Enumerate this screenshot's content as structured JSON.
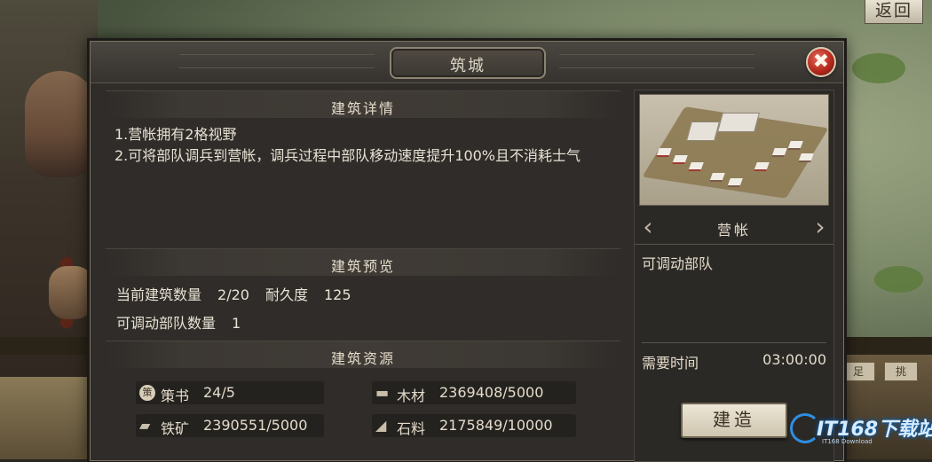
{
  "background": {
    "back_button": "返回",
    "right_tabs": [
      "足",
      "挑"
    ]
  },
  "dialog": {
    "title": "筑城",
    "close_glyph": "✖",
    "sections": {
      "details_header": "建筑详情",
      "details_lines": [
        "1.营帐拥有2格视野",
        "2.可将部队调兵到营帐，调兵过程中部队移动速度提升100%且不消耗士气"
      ],
      "preview_header": "建筑预览",
      "preview_stats": {
        "current_count_label": "当前建筑数量",
        "current_count_value": "2/20",
        "durability_label": "耐久度",
        "durability_value": "125",
        "troops_label": "可调动部队数量",
        "troops_value": "1"
      },
      "resources_header": "建筑资源",
      "resources": [
        {
          "icon": "strategy-book-icon",
          "glyph": "策",
          "label": "策书",
          "value": "24/5"
        },
        {
          "icon": "wood-icon",
          "glyph": "▬",
          "label": "木材",
          "value": "2369408/5000"
        },
        {
          "icon": "iron-ore-icon",
          "glyph": "▰",
          "label": "铁矿",
          "value": "2390551/5000"
        },
        {
          "icon": "stone-icon",
          "glyph": "◢",
          "label": "石料",
          "value": "2175849/10000"
        }
      ]
    },
    "building": {
      "name": "营帐",
      "feature": "可调动部队",
      "time_label": "需要时间",
      "time_value": "03:00:00",
      "build_button": "建造",
      "prev_glyph": "‹",
      "next_glyph": "›"
    }
  },
  "watermark": {
    "text": "IT168下载站",
    "sub": "IT168 Download"
  }
}
